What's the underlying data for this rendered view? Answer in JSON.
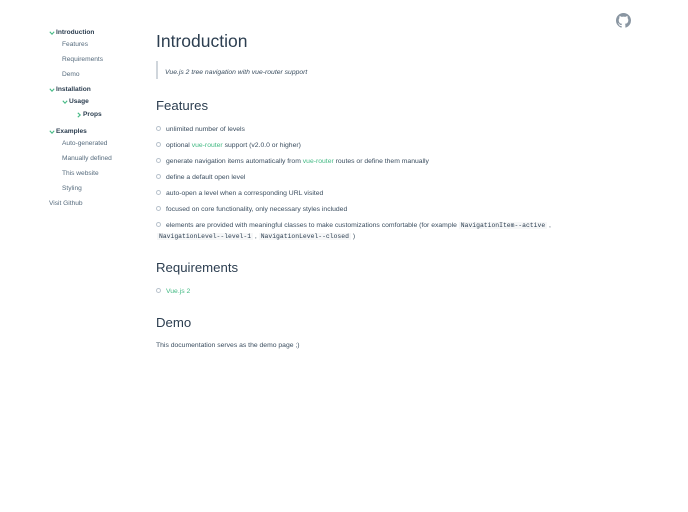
{
  "sidebar": {
    "introduction": "Introduction",
    "features": "Features",
    "requirements": "Requirements",
    "demo": "Demo",
    "installation": "Installation",
    "usage": "Usage",
    "props": "Props",
    "examples": "Examples",
    "auto_generated": "Auto-generated",
    "manually_defined": "Manually defined",
    "this_website": "This website",
    "styling": "Styling",
    "visit_github": "Visit Github"
  },
  "main": {
    "title": "Introduction",
    "quote": "Vue.js 2 tree navigation with vue-router support",
    "features_heading": "Features",
    "features": {
      "f1": "unlimited number of levels",
      "f2_pre": "optional ",
      "f2_link": "vue-router",
      "f2_post": " support (v2.0.0 or higher)",
      "f3_pre": "generate navigation items automatically from ",
      "f3_link": "vue-router",
      "f3_post": " routes or define them manually",
      "f4": "define a default open level",
      "f5": "auto-open a level when a corresponding URL visited",
      "f6": "focused on core functionality, only necessary styles included",
      "f7_pre": "elements are provided with meaningful classes to make customizations comfortable (for example ",
      "f7_code1": "NavigationItem--active",
      "f7_sep1": " ,",
      "f7_code2": "NavigationLevel--level-1",
      "f7_sep2": " , ",
      "f7_code3": "NavigationLevel--closed",
      "f7_post": " )"
    },
    "requirements_heading": "Requirements",
    "requirement_link": "Vue.js 2",
    "demo_heading": "Demo",
    "demo_text": "This documentation serves as the demo page ;)"
  },
  "colors": {
    "accent": "#42b983",
    "text": "#2c3e50",
    "muted": "#566b7d"
  },
  "icons": {
    "github": "github-icon",
    "expanded": "chevron-down-icon",
    "collapsed": "chevron-right-icon"
  }
}
